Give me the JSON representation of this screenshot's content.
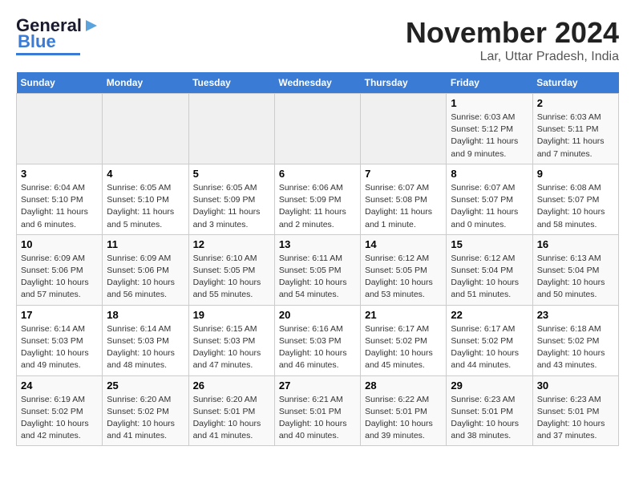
{
  "header": {
    "logo_line1": "General",
    "logo_line2": "Blue",
    "month": "November 2024",
    "location": "Lar, Uttar Pradesh, India"
  },
  "weekdays": [
    "Sunday",
    "Monday",
    "Tuesday",
    "Wednesday",
    "Thursday",
    "Friday",
    "Saturday"
  ],
  "weeks": [
    [
      {
        "day": "",
        "info": ""
      },
      {
        "day": "",
        "info": ""
      },
      {
        "day": "",
        "info": ""
      },
      {
        "day": "",
        "info": ""
      },
      {
        "day": "",
        "info": ""
      },
      {
        "day": "1",
        "info": "Sunrise: 6:03 AM\nSunset: 5:12 PM\nDaylight: 11 hours and 9 minutes."
      },
      {
        "day": "2",
        "info": "Sunrise: 6:03 AM\nSunset: 5:11 PM\nDaylight: 11 hours and 7 minutes."
      }
    ],
    [
      {
        "day": "3",
        "info": "Sunrise: 6:04 AM\nSunset: 5:10 PM\nDaylight: 11 hours and 6 minutes."
      },
      {
        "day": "4",
        "info": "Sunrise: 6:05 AM\nSunset: 5:10 PM\nDaylight: 11 hours and 5 minutes."
      },
      {
        "day": "5",
        "info": "Sunrise: 6:05 AM\nSunset: 5:09 PM\nDaylight: 11 hours and 3 minutes."
      },
      {
        "day": "6",
        "info": "Sunrise: 6:06 AM\nSunset: 5:09 PM\nDaylight: 11 hours and 2 minutes."
      },
      {
        "day": "7",
        "info": "Sunrise: 6:07 AM\nSunset: 5:08 PM\nDaylight: 11 hours and 1 minute."
      },
      {
        "day": "8",
        "info": "Sunrise: 6:07 AM\nSunset: 5:07 PM\nDaylight: 11 hours and 0 minutes."
      },
      {
        "day": "9",
        "info": "Sunrise: 6:08 AM\nSunset: 5:07 PM\nDaylight: 10 hours and 58 minutes."
      }
    ],
    [
      {
        "day": "10",
        "info": "Sunrise: 6:09 AM\nSunset: 5:06 PM\nDaylight: 10 hours and 57 minutes."
      },
      {
        "day": "11",
        "info": "Sunrise: 6:09 AM\nSunset: 5:06 PM\nDaylight: 10 hours and 56 minutes."
      },
      {
        "day": "12",
        "info": "Sunrise: 6:10 AM\nSunset: 5:05 PM\nDaylight: 10 hours and 55 minutes."
      },
      {
        "day": "13",
        "info": "Sunrise: 6:11 AM\nSunset: 5:05 PM\nDaylight: 10 hours and 54 minutes."
      },
      {
        "day": "14",
        "info": "Sunrise: 6:12 AM\nSunset: 5:05 PM\nDaylight: 10 hours and 53 minutes."
      },
      {
        "day": "15",
        "info": "Sunrise: 6:12 AM\nSunset: 5:04 PM\nDaylight: 10 hours and 51 minutes."
      },
      {
        "day": "16",
        "info": "Sunrise: 6:13 AM\nSunset: 5:04 PM\nDaylight: 10 hours and 50 minutes."
      }
    ],
    [
      {
        "day": "17",
        "info": "Sunrise: 6:14 AM\nSunset: 5:03 PM\nDaylight: 10 hours and 49 minutes."
      },
      {
        "day": "18",
        "info": "Sunrise: 6:14 AM\nSunset: 5:03 PM\nDaylight: 10 hours and 48 minutes."
      },
      {
        "day": "19",
        "info": "Sunrise: 6:15 AM\nSunset: 5:03 PM\nDaylight: 10 hours and 47 minutes."
      },
      {
        "day": "20",
        "info": "Sunrise: 6:16 AM\nSunset: 5:03 PM\nDaylight: 10 hours and 46 minutes."
      },
      {
        "day": "21",
        "info": "Sunrise: 6:17 AM\nSunset: 5:02 PM\nDaylight: 10 hours and 45 minutes."
      },
      {
        "day": "22",
        "info": "Sunrise: 6:17 AM\nSunset: 5:02 PM\nDaylight: 10 hours and 44 minutes."
      },
      {
        "day": "23",
        "info": "Sunrise: 6:18 AM\nSunset: 5:02 PM\nDaylight: 10 hours and 43 minutes."
      }
    ],
    [
      {
        "day": "24",
        "info": "Sunrise: 6:19 AM\nSunset: 5:02 PM\nDaylight: 10 hours and 42 minutes."
      },
      {
        "day": "25",
        "info": "Sunrise: 6:20 AM\nSunset: 5:02 PM\nDaylight: 10 hours and 41 minutes."
      },
      {
        "day": "26",
        "info": "Sunrise: 6:20 AM\nSunset: 5:01 PM\nDaylight: 10 hours and 41 minutes."
      },
      {
        "day": "27",
        "info": "Sunrise: 6:21 AM\nSunset: 5:01 PM\nDaylight: 10 hours and 40 minutes."
      },
      {
        "day": "28",
        "info": "Sunrise: 6:22 AM\nSunset: 5:01 PM\nDaylight: 10 hours and 39 minutes."
      },
      {
        "day": "29",
        "info": "Sunrise: 6:23 AM\nSunset: 5:01 PM\nDaylight: 10 hours and 38 minutes."
      },
      {
        "day": "30",
        "info": "Sunrise: 6:23 AM\nSunset: 5:01 PM\nDaylight: 10 hours and 37 minutes."
      }
    ]
  ]
}
